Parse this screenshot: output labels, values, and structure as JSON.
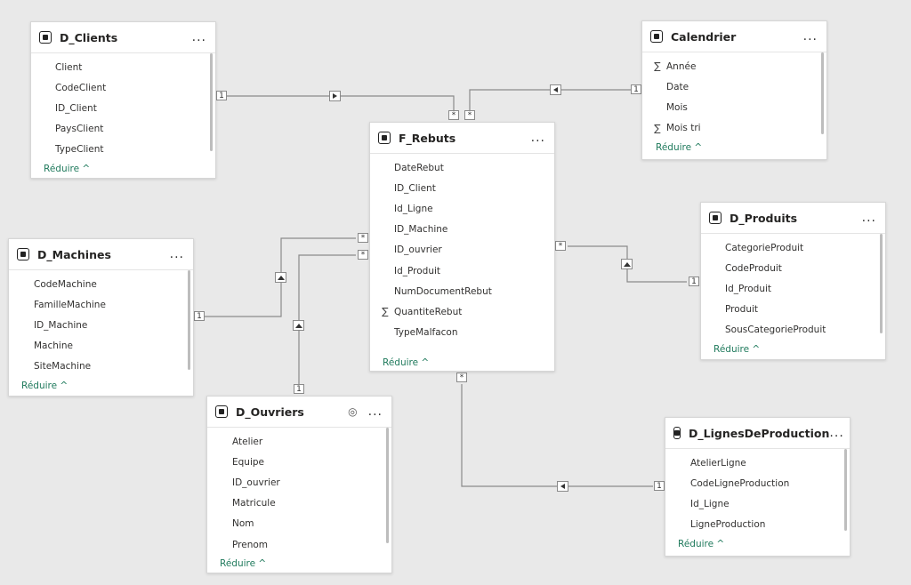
{
  "colors": {
    "canvas": "#e9e9e9",
    "card": "#ffffff",
    "link": "#8a8a8a",
    "collapse": "#1f7a5c"
  },
  "tables": {
    "clients": {
      "title": "D_Clients",
      "more": "...",
      "collapse": "Réduire ^",
      "fields": [
        {
          "name": "Client"
        },
        {
          "name": "CodeClient"
        },
        {
          "name": "ID_Client"
        },
        {
          "name": "PaysClient"
        },
        {
          "name": "TypeClient"
        }
      ]
    },
    "calendrier": {
      "title": "Calendrier",
      "more": "...",
      "collapse": "Réduire ^",
      "fields": [
        {
          "name": "Année",
          "sigma": "∑"
        },
        {
          "name": "Date"
        },
        {
          "name": "Mois"
        },
        {
          "name": "Mois tri",
          "sigma": "∑"
        }
      ]
    },
    "rebuts": {
      "title": "F_Rebuts",
      "more": "...",
      "collapse": "Réduire ^",
      "fields": [
        {
          "name": "DateRebut"
        },
        {
          "name": "ID_Client"
        },
        {
          "name": "Id_Ligne"
        },
        {
          "name": "ID_Machine"
        },
        {
          "name": "ID_ouvrier"
        },
        {
          "name": "Id_Produit"
        },
        {
          "name": "NumDocumentRebut"
        },
        {
          "name": "QuantiteRebut",
          "sigma": "∑"
        },
        {
          "name": "TypeMalfacon"
        }
      ]
    },
    "produits": {
      "title": "D_Produits",
      "more": "...",
      "collapse": "Réduire ^",
      "fields": [
        {
          "name": "CategorieProduit"
        },
        {
          "name": "CodeProduit"
        },
        {
          "name": "Id_Produit"
        },
        {
          "name": "Produit"
        },
        {
          "name": "SousCategorieProduit"
        }
      ]
    },
    "machines": {
      "title": "D_Machines",
      "more": "...",
      "collapse": "Réduire ^",
      "fields": [
        {
          "name": "CodeMachine"
        },
        {
          "name": "FamilleMachine"
        },
        {
          "name": "ID_Machine"
        },
        {
          "name": "Machine"
        },
        {
          "name": "SiteMachine"
        }
      ]
    },
    "ouvriers": {
      "title": "D_Ouvriers",
      "more": "...",
      "collapse": "Réduire ^",
      "fields": [
        {
          "name": "Atelier"
        },
        {
          "name": "Equipe"
        },
        {
          "name": "ID_ouvrier"
        },
        {
          "name": "Matricule"
        },
        {
          "name": "Nom"
        },
        {
          "name": "Prenom"
        }
      ]
    },
    "lignes": {
      "title": "D_LignesDeProduction",
      "more": "...",
      "collapse": "Réduire ^",
      "fields": [
        {
          "name": "AtelierLigne"
        },
        {
          "name": "CodeLigneProduction"
        },
        {
          "name": "Id_Ligne"
        },
        {
          "name": "LigneProduction"
        }
      ]
    }
  },
  "cardinality": {
    "one": "1",
    "many": "*"
  }
}
